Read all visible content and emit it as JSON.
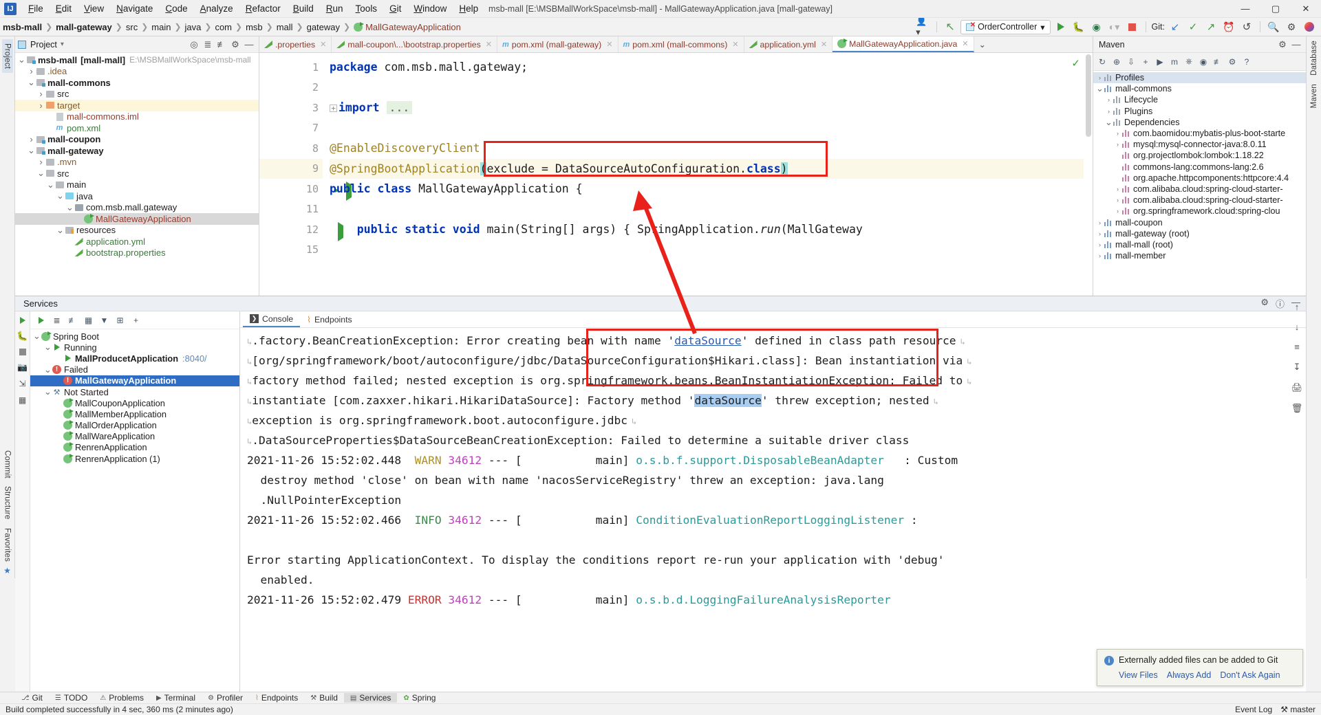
{
  "window": {
    "title": "msb-mall [E:\\MSBMallWorkSpace\\msb-mall] - MallGatewayApplication.java [mall-gateway]",
    "minimize": "—",
    "maximize": "▢",
    "close": "✕"
  },
  "menu": [
    "File",
    "Edit",
    "View",
    "Navigate",
    "Code",
    "Analyze",
    "Refactor",
    "Build",
    "Run",
    "Tools",
    "Git",
    "Window",
    "Help"
  ],
  "breadcrumb": [
    {
      "label": "msb-mall",
      "style": "bold"
    },
    {
      "label": "mall-gateway",
      "style": "bold"
    },
    {
      "label": "src",
      "style": "normal"
    },
    {
      "label": "main",
      "style": "normal"
    },
    {
      "label": "java",
      "style": "normal"
    },
    {
      "label": "com",
      "style": "normal"
    },
    {
      "label": "msb",
      "style": "normal"
    },
    {
      "label": "mall",
      "style": "normal"
    },
    {
      "label": "gateway",
      "style": "normal"
    },
    {
      "label": "MallGatewayApplication",
      "style": "file"
    }
  ],
  "toolbar": {
    "run_config": "OrderController",
    "git_label": "Git:",
    "search_icon": "search-icon",
    "settings_icon": "gear-icon"
  },
  "project": {
    "header": "Project",
    "tree": [
      {
        "depth": 0,
        "arrow": "v",
        "icon": "module",
        "label": "msb-mall",
        "bold": true,
        "suffix": "[mall-mall]",
        "path": "E:\\MSBMallWorkSpace\\msb-mall"
      },
      {
        "depth": 1,
        "arrow": ">",
        "icon": "folder",
        "label": ".idea",
        "color": "brown"
      },
      {
        "depth": 1,
        "arrow": "v",
        "icon": "module",
        "label": "mall-commons",
        "bold": true
      },
      {
        "depth": 2,
        "arrow": ">",
        "icon": "folder",
        "label": "src"
      },
      {
        "depth": 2,
        "arrow": ">",
        "icon": "folder-orange",
        "label": "target",
        "color": "brown",
        "highlight": "yellow"
      },
      {
        "depth": 3,
        "arrow": "",
        "icon": "iml",
        "label": "mall-commons.iml",
        "color": "red"
      },
      {
        "depth": 3,
        "arrow": "",
        "icon": "maven",
        "label": "pom.xml",
        "color": "green"
      },
      {
        "depth": 1,
        "arrow": ">",
        "icon": "module",
        "label": "mall-coupon",
        "bold": true
      },
      {
        "depth": 1,
        "arrow": "v",
        "icon": "module",
        "label": "mall-gateway",
        "bold": true
      },
      {
        "depth": 2,
        "arrow": ">",
        "icon": "folder",
        "label": ".mvn",
        "color": "brown"
      },
      {
        "depth": 2,
        "arrow": "v",
        "icon": "folder",
        "label": "src"
      },
      {
        "depth": 3,
        "arrow": "v",
        "icon": "folder",
        "label": "main"
      },
      {
        "depth": 4,
        "arrow": "v",
        "icon": "folder-blue",
        "label": "java"
      },
      {
        "depth": 5,
        "arrow": "v",
        "icon": "package",
        "label": "com.msb.mall.gateway"
      },
      {
        "depth": 6,
        "arrow": "",
        "icon": "spring-class",
        "label": "MallGatewayApplication",
        "color": "red",
        "highlight": "gray"
      },
      {
        "depth": 4,
        "arrow": "v",
        "icon": "folder-res",
        "label": "resources"
      },
      {
        "depth": 5,
        "arrow": "",
        "icon": "yml",
        "label": "application.yml",
        "color": "green"
      },
      {
        "depth": 5,
        "arrow": "",
        "icon": "yml",
        "label": "bootstrap.properties",
        "color": "green"
      }
    ]
  },
  "editor": {
    "tabs": [
      {
        "label": ".properties",
        "icon": "yml-icon",
        "active": false
      },
      {
        "label": "mall-coupon\\...\\bootstrap.properties",
        "icon": "yml-icon",
        "active": false
      },
      {
        "label": "pom.xml (mall-gateway)",
        "icon": "maven-icon",
        "active": false
      },
      {
        "label": "pom.xml (mall-commons)",
        "icon": "maven-icon",
        "active": false
      },
      {
        "label": "application.yml",
        "icon": "yml-icon",
        "active": false
      },
      {
        "label": "MallGatewayApplication.java",
        "icon": "spring-class-icon",
        "active": true
      }
    ],
    "lines": [
      {
        "no": "1",
        "highlight": false,
        "segments": [
          {
            "t": "package ",
            "c": "kw"
          },
          {
            "t": "com.msb.mall.gateway;",
            "c": "pl"
          }
        ]
      },
      {
        "no": "2",
        "highlight": false,
        "segments": []
      },
      {
        "no": "3",
        "highlight": false,
        "fold": true,
        "segments": [
          {
            "t": "import ",
            "c": "kw"
          },
          {
            "t": "...",
            "c": "fold"
          }
        ]
      },
      {
        "no": "7",
        "highlight": false,
        "segments": []
      },
      {
        "no": "8",
        "highlight": false,
        "segments": [
          {
            "t": "@EnableDiscoveryClient",
            "c": "ann"
          }
        ]
      },
      {
        "no": "9",
        "highlight": true,
        "segments": [
          {
            "t": "@SpringBootApplication",
            "c": "ann"
          },
          {
            "t": "(",
            "c": "sel"
          },
          {
            "t": "exclude = DataSourceAutoConfiguration.",
            "c": "pl"
          },
          {
            "t": "class",
            "c": "kw"
          },
          {
            "t": ")",
            "c": "sel"
          }
        ]
      },
      {
        "no": "10",
        "highlight": false,
        "segments": [
          {
            "t": "public ",
            "c": "kw"
          },
          {
            "t": "class ",
            "c": "kw"
          },
          {
            "t": "MallGatewayApplication {",
            "c": "pl"
          }
        ]
      },
      {
        "no": "11",
        "highlight": false,
        "segments": []
      },
      {
        "no": "12",
        "highlight": false,
        "segments": [
          {
            "t": "    public static void ",
            "c": "kw"
          },
          {
            "t": "main(String[] args) { SpringApplication.",
            "c": "pl"
          },
          {
            "t": "run",
            "c": "italic"
          },
          {
            "t": "(MallGateway",
            "c": "pl"
          }
        ]
      },
      {
        "no": "15",
        "highlight": false,
        "segments": []
      }
    ]
  },
  "maven": {
    "header": "Maven",
    "tree": [
      {
        "depth": 0,
        "arrow": ">",
        "icon": "profiles",
        "label": "Profiles",
        "highlight": true
      },
      {
        "depth": 0,
        "arrow": "v",
        "icon": "mvn",
        "label": "mall-commons"
      },
      {
        "depth": 1,
        "arrow": ">",
        "icon": "lifecycle",
        "label": "Lifecycle"
      },
      {
        "depth": 1,
        "arrow": ">",
        "icon": "plugins",
        "label": "Plugins"
      },
      {
        "depth": 1,
        "arrow": "v",
        "icon": "deps",
        "label": "Dependencies"
      },
      {
        "depth": 2,
        "arrow": ">",
        "icon": "dep",
        "label": "com.baomidou:mybatis-plus-boot-starte"
      },
      {
        "depth": 2,
        "arrow": ">",
        "icon": "dep",
        "label": "mysql:mysql-connector-java:8.0.11"
      },
      {
        "depth": 2,
        "arrow": "",
        "icon": "dep",
        "label": "org.projectlombok:lombok:1.18.22"
      },
      {
        "depth": 2,
        "arrow": "",
        "icon": "dep",
        "label": "commons-lang:commons-lang:2.6"
      },
      {
        "depth": 2,
        "arrow": "",
        "icon": "dep",
        "label": "org.apache.httpcomponents:httpcore:4.4"
      },
      {
        "depth": 2,
        "arrow": ">",
        "icon": "dep",
        "label": "com.alibaba.cloud:spring-cloud-starter-"
      },
      {
        "depth": 2,
        "arrow": ">",
        "icon": "dep",
        "label": "com.alibaba.cloud:spring-cloud-starter-"
      },
      {
        "depth": 2,
        "arrow": ">",
        "icon": "dep",
        "label": "org.springframework.cloud:spring-clou"
      },
      {
        "depth": 0,
        "arrow": ">",
        "icon": "mvn",
        "label": "mall-coupon"
      },
      {
        "depth": 0,
        "arrow": ">",
        "icon": "mvn",
        "label": "mall-gateway (root)"
      },
      {
        "depth": 0,
        "arrow": ">",
        "icon": "mvn",
        "label": "mall-mall (root)"
      },
      {
        "depth": 0,
        "arrow": ">",
        "icon": "mvn",
        "label": "mall-member"
      }
    ]
  },
  "services": {
    "title": "Services",
    "tree": [
      {
        "depth": 0,
        "arrow": "v",
        "icon": "spring",
        "label": "Spring Boot",
        "bold": false
      },
      {
        "depth": 1,
        "arrow": "v",
        "icon": "run",
        "label": "Running"
      },
      {
        "depth": 2,
        "arrow": "",
        "icon": "run",
        "label": "MallProducetApplication",
        "bold": true,
        "port": ":8040/"
      },
      {
        "depth": 1,
        "arrow": "v",
        "icon": "error",
        "label": "Failed"
      },
      {
        "depth": 2,
        "arrow": "",
        "icon": "error",
        "label": "MallGatewayApplication",
        "bold": true,
        "selected": true
      },
      {
        "depth": 1,
        "arrow": "v",
        "icon": "wrench",
        "label": "Not Started"
      },
      {
        "depth": 2,
        "arrow": "",
        "icon": "spring",
        "label": "MallCouponApplication"
      },
      {
        "depth": 2,
        "arrow": "",
        "icon": "spring",
        "label": "MallMemberApplication"
      },
      {
        "depth": 2,
        "arrow": "",
        "icon": "spring",
        "label": "MallOrderApplication"
      },
      {
        "depth": 2,
        "arrow": "",
        "icon": "spring",
        "label": "MallWareApplication"
      },
      {
        "depth": 2,
        "arrow": "",
        "icon": "spring",
        "label": "RenrenApplication"
      },
      {
        "depth": 2,
        "arrow": "",
        "icon": "spring",
        "label": "RenrenApplication (1)"
      }
    ],
    "console_tabs": [
      {
        "label": "Console",
        "active": true,
        "icon": "console-icon"
      },
      {
        "label": "Endpoints",
        "active": false,
        "icon": "endpoints-icon"
      }
    ],
    "console_lines": [
      {
        "wrap": true,
        "segments": [
          {
            "t": ".factory.BeanCreationException: Error creating bean with name '"
          },
          {
            "t": "dataSource",
            "c": "link"
          },
          {
            "t": "' defined in class path resource"
          }
        ],
        "tail": true
      },
      {
        "wrap": true,
        "segments": [
          {
            "t": "[org/springframework/boot/autoconfigure/jdbc/DataSourceConfiguration$Hikari.class]: Bean instantiation via"
          }
        ],
        "tail": true
      },
      {
        "wrap": true,
        "segments": [
          {
            "t": "factory method failed; nested exception is org.springframework.beans.BeanInstantiationException: Failed to"
          }
        ],
        "tail": true
      },
      {
        "wrap": true,
        "segments": [
          {
            "t": "instantiate [com.zaxxer.hikari.HikariDataSource]: Factory method '"
          },
          {
            "t": "dataSource",
            "c": "selblue"
          },
          {
            "t": "' threw exception; nested"
          }
        ],
        "tail": true
      },
      {
        "wrap": true,
        "segments": [
          {
            "t": "exception is org.springframework.boot.autoconfigure.jdbc"
          }
        ],
        "tail": true
      },
      {
        "wrap": true,
        "segments": [
          {
            "t": ".DataSourceProperties$DataSourceBeanCreationException: Failed to determine a suitable driver class"
          }
        ]
      },
      {
        "wrap": false,
        "segments": [
          {
            "t": "2021-11-26 15:52:02.448  "
          },
          {
            "t": "WARN",
            "c": "warn"
          },
          {
            "t": " "
          },
          {
            "t": "34612",
            "c": "num"
          },
          {
            "t": " --- [           main] "
          },
          {
            "t": "o.s.b.f.support.DisposableBeanAdapter",
            "c": "cls"
          },
          {
            "t": "   : Custom"
          }
        ]
      },
      {
        "wrap": false,
        "segments": [
          {
            "t": "  destroy method 'close' on bean with name 'nacosServiceRegistry' threw an exception: java.lang"
          }
        ]
      },
      {
        "wrap": false,
        "segments": [
          {
            "t": "  .NullPointerException"
          }
        ]
      },
      {
        "wrap": false,
        "segments": [
          {
            "t": "2021-11-26 15:52:02.466  "
          },
          {
            "t": "INFO",
            "c": "info"
          },
          {
            "t": " "
          },
          {
            "t": "34612",
            "c": "num"
          },
          {
            "t": " --- [           main] "
          },
          {
            "t": "ConditionEvaluationReportLoggingListener",
            "c": "cls"
          },
          {
            "t": " :"
          }
        ]
      },
      {
        "wrap": false,
        "segments": [
          {
            "t": ""
          }
        ]
      },
      {
        "wrap": false,
        "segments": [
          {
            "t": "Error starting ApplicationContext. To display the conditions report re-run your application with 'debug'"
          }
        ]
      },
      {
        "wrap": false,
        "segments": [
          {
            "t": "  enabled."
          }
        ]
      },
      {
        "wrap": false,
        "segments": [
          {
            "t": "2021-11-26 15:52:02.479 "
          },
          {
            "t": "ERROR",
            "c": "err"
          },
          {
            "t": " "
          },
          {
            "t": "34612",
            "c": "num"
          },
          {
            "t": " --- [           main] "
          },
          {
            "t": "o.s.b.d.LoggingFailureAnalysisReporter",
            "c": "cls"
          }
        ]
      }
    ]
  },
  "notification": {
    "message": "Externally added files can be added to Git",
    "links": [
      "View Files",
      "Always Add",
      "Don't Ask Again"
    ]
  },
  "bottom_tools": [
    {
      "label": "Git",
      "icon": "git-icon",
      "active": false
    },
    {
      "label": "TODO",
      "icon": "todo-icon",
      "active": false
    },
    {
      "label": "Problems",
      "icon": "problems-icon",
      "active": false
    },
    {
      "label": "Terminal",
      "icon": "terminal-icon",
      "active": false
    },
    {
      "label": "Profiler",
      "icon": "profiler-icon",
      "active": false
    },
    {
      "label": "Endpoints",
      "icon": "endpoints-icon",
      "active": false
    },
    {
      "label": "Build",
      "icon": "build-icon",
      "active": false
    },
    {
      "label": "Services",
      "icon": "services-icon",
      "active": true
    },
    {
      "label": "Spring",
      "icon": "spring-icon",
      "active": false
    }
  ],
  "statusbar": {
    "message": "Build completed successfully in 4 sec, 360 ms (2 minutes ago)",
    "event_log": "Event Log",
    "branch": "master"
  },
  "left_strip": [
    "Project",
    "Commit",
    "Structure",
    "Favorites"
  ],
  "right_strip": [
    "Database",
    "Maven"
  ],
  "colors": {
    "accent": "#2f6dc4",
    "error": "#e05a52",
    "annotation_red": "#e8211a",
    "keyword": "#0033b3",
    "annotation_text": "#9e8224"
  }
}
